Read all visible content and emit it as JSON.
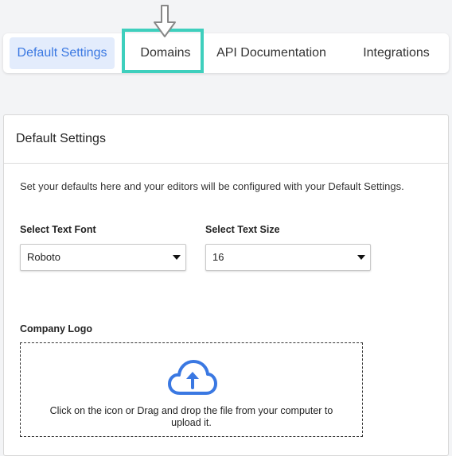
{
  "tabs": [
    {
      "label": "Default Settings",
      "active": true
    },
    {
      "label": "Domains",
      "active": false,
      "highlighted": true
    },
    {
      "label": "API Documentation",
      "active": false
    },
    {
      "label": "Integrations",
      "active": false
    }
  ],
  "card": {
    "title": "Default Settings",
    "intro": "Set your defaults here and your editors will be configured with your Default Settings.",
    "font_field": {
      "label": "Select Text Font",
      "value": "Roboto"
    },
    "size_field": {
      "label": "Select Text Size",
      "value": "16"
    },
    "logo": {
      "label": "Company Logo",
      "icon": "cloud-upload-icon",
      "hint": "Click on the icon or Drag and drop the file from your computer to upload it."
    }
  },
  "colors": {
    "accent": "#3a78e2",
    "active_tab_bg": "#e3ecfc",
    "highlight": "#3ecfbd"
  }
}
